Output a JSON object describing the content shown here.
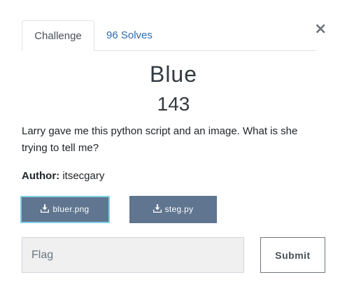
{
  "tabs": {
    "challenge": "Challenge",
    "solves": "96 Solves"
  },
  "close_symbol": "×",
  "challenge": {
    "name": "Blue",
    "value": "143",
    "description": "Larry gave me this python script and an image. What is she trying to tell me?",
    "author_label": "Author:",
    "author_name": "itsecgary"
  },
  "files": [
    {
      "name": "bluer.png",
      "icon": "download-icon"
    },
    {
      "name": "steg.py",
      "icon": "download-icon"
    }
  ],
  "flag_input": {
    "placeholder": "Flag",
    "value": ""
  },
  "submit_label": "Submit",
  "colors": {
    "file_button_bg": "#5f7590",
    "file_button_focus_border": "#7fd0e6",
    "link": "#2c6bac",
    "input_bg": "#f0f0f0"
  }
}
